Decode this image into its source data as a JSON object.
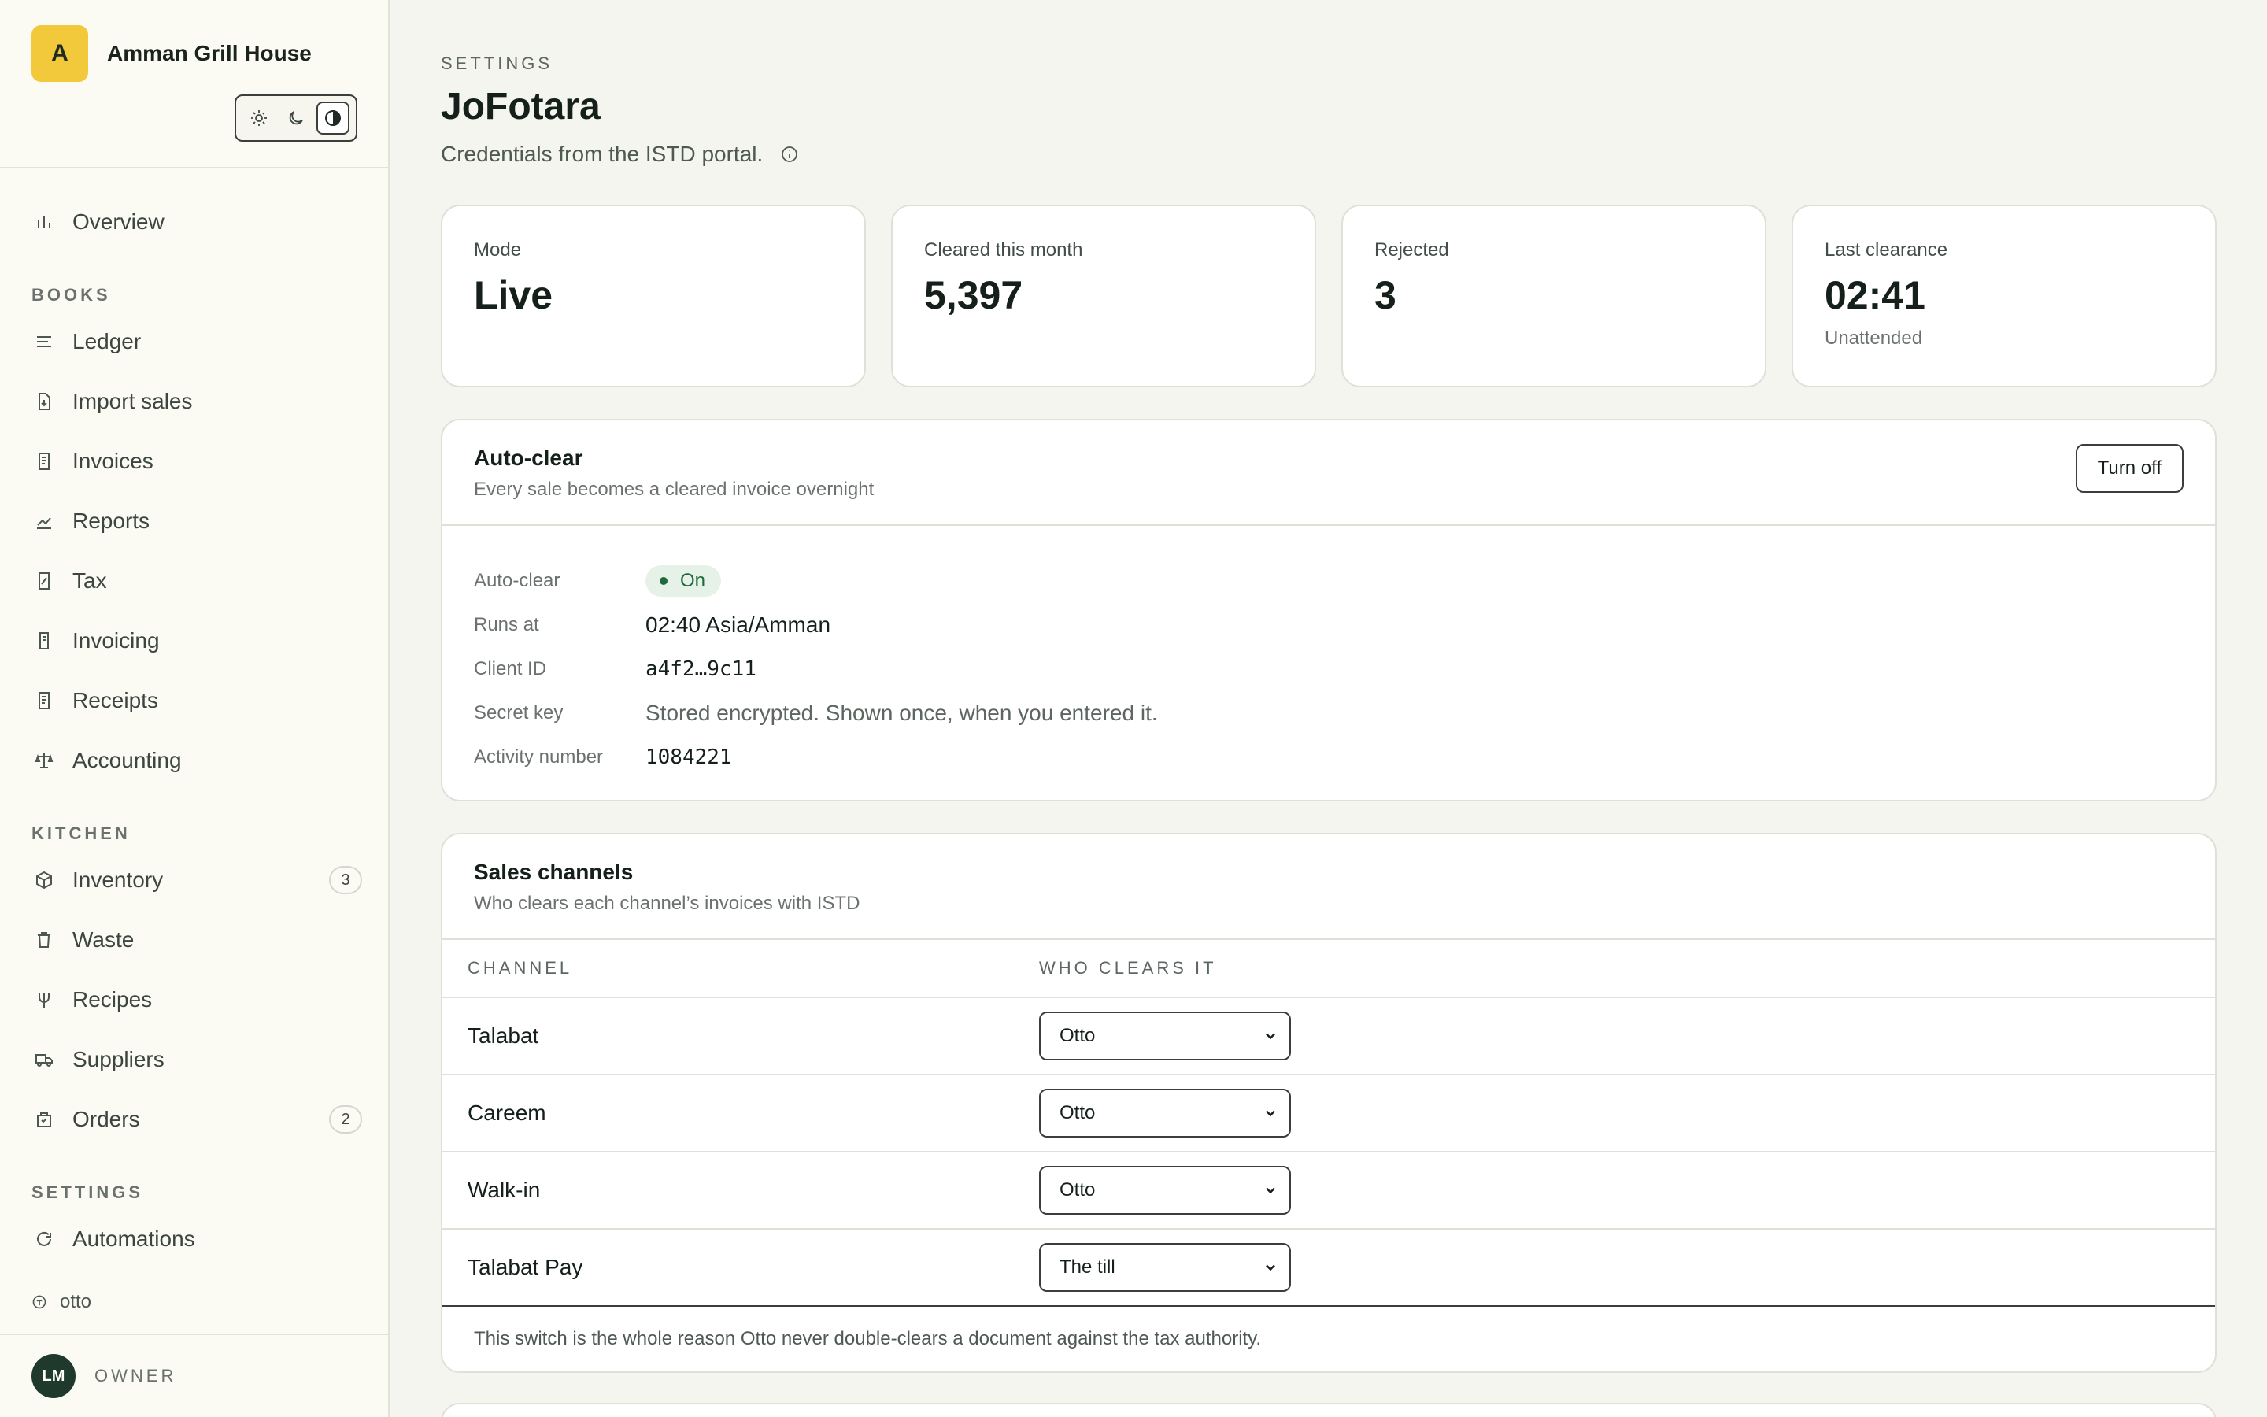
{
  "brand": {
    "initial": "A",
    "name": "Amman Grill House"
  },
  "nav": {
    "overview": "Overview",
    "books_label": "BOOKS",
    "books": [
      {
        "label": "Ledger",
        "icon": "lines-icon"
      },
      {
        "label": "Import sales",
        "icon": "file-import-icon"
      },
      {
        "label": "Invoices",
        "icon": "receipt-icon"
      },
      {
        "label": "Reports",
        "icon": "trend-icon"
      },
      {
        "label": "Tax",
        "icon": "percent-doc-icon"
      },
      {
        "label": "Invoicing",
        "icon": "doc-icon"
      },
      {
        "label": "Receipts",
        "icon": "receipt-icon"
      },
      {
        "label": "Accounting",
        "icon": "scale-icon"
      }
    ],
    "kitchen_label": "KITCHEN",
    "kitchen": [
      {
        "label": "Inventory",
        "icon": "box-icon",
        "badge": "3"
      },
      {
        "label": "Waste",
        "icon": "trash-icon"
      },
      {
        "label": "Recipes",
        "icon": "fork-icon"
      },
      {
        "label": "Suppliers",
        "icon": "truck-icon"
      },
      {
        "label": "Orders",
        "icon": "bag-icon",
        "badge": "2"
      }
    ],
    "settings_label": "SETTINGS",
    "settings": [
      {
        "label": "Automations",
        "icon": "refresh-icon"
      }
    ],
    "otto": "otto"
  },
  "user": {
    "initials": "LM",
    "role": "OWNER"
  },
  "page": {
    "eyebrow": "SETTINGS",
    "title": "JoFotara",
    "subtitle": "Credentials from the ISTD portal."
  },
  "stats": [
    {
      "label": "Mode",
      "value": "Live",
      "note": ""
    },
    {
      "label": "Cleared this month",
      "value": "5,397",
      "note": ""
    },
    {
      "label": "Rejected",
      "value": "3",
      "note": ""
    },
    {
      "label": "Last clearance",
      "value": "02:41",
      "note": "Unattended"
    }
  ],
  "autoclear": {
    "title": "Auto-clear",
    "subtitle": "Every sale becomes a cleared invoice overnight",
    "button": "Turn off",
    "rows": {
      "autoclear_key": "Auto-clear",
      "autoclear_val": "On",
      "runs_key": "Runs at",
      "runs_val": "02:40 Asia/Amman",
      "client_key": "Client ID",
      "client_val": "a4f2…9c11",
      "secret_key": "Secret key",
      "secret_val": "Stored encrypted. Shown once, when you entered it.",
      "activity_key": "Activity number",
      "activity_val": "1084221"
    },
    "status_color": "#1e6a3a"
  },
  "channels": {
    "title": "Sales channels",
    "subtitle": "Who clears each channel’s invoices with ISTD",
    "col_channel": "CHANNEL",
    "col_who": "WHO CLEARS IT",
    "rows": [
      {
        "channel": "Talabat",
        "who": "Otto"
      },
      {
        "channel": "Careem",
        "who": "Otto"
      },
      {
        "channel": "Walk-in",
        "who": "Otto"
      },
      {
        "channel": "Talabat Pay",
        "who": "The till"
      }
    ],
    "footer": "This switch is the whole reason Otto never double-clears a document against the tax authority."
  },
  "colors": {
    "brand_yellow": "#f2c93a",
    "avatar_green": "#1f3a2c",
    "background": "#f5f5f0"
  }
}
